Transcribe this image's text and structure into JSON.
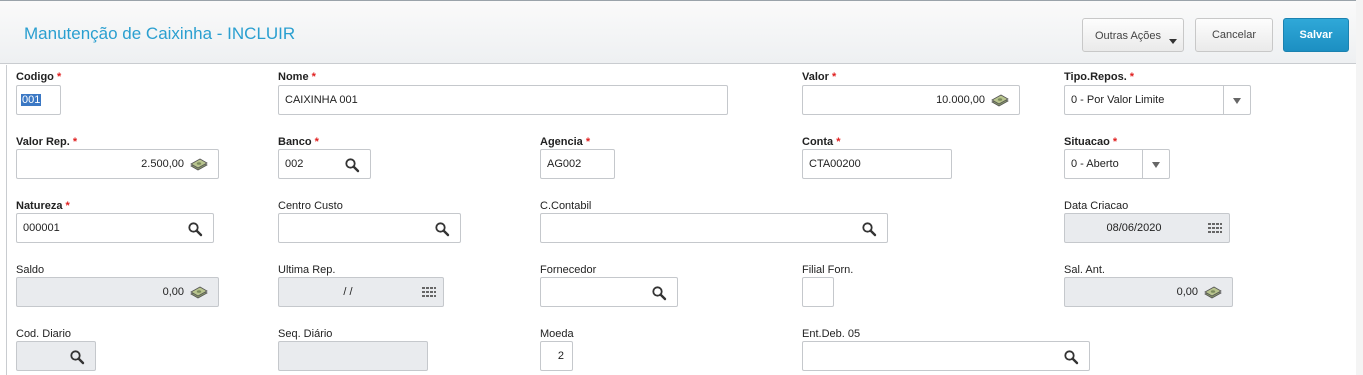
{
  "header": {
    "title": "Manutenção de Caixinha - INCLUIR",
    "buttons": {
      "other": "Outras Ações",
      "cancel": "Cancelar",
      "save": "Salvar"
    }
  },
  "fields": {
    "codigo": {
      "label": "Codigo",
      "value": "001"
    },
    "nome": {
      "label": "Nome",
      "value": "CAIXINHA 001"
    },
    "valor": {
      "label": "Valor",
      "value": "10.000,00"
    },
    "tipo_repos": {
      "label": "Tipo.Repos.",
      "value": "0 - Por Valor Limite"
    },
    "valor_rep": {
      "label": "Valor Rep.",
      "value": "2.500,00"
    },
    "banco": {
      "label": "Banco",
      "value": "002"
    },
    "agencia": {
      "label": "Agencia",
      "value": "AG002"
    },
    "conta": {
      "label": "Conta",
      "value": "CTA00200"
    },
    "situacao": {
      "label": "Situacao",
      "value": "0 - Aberto"
    },
    "natureza": {
      "label": "Natureza",
      "value": "000001"
    },
    "centro_custo": {
      "label": "Centro Custo",
      "value": ""
    },
    "c_contabil": {
      "label": "C.Contabil",
      "value": ""
    },
    "data_criacao": {
      "label": "Data Criacao",
      "value": "08/06/2020"
    },
    "saldo": {
      "label": "Saldo",
      "value": "0,00"
    },
    "ultima_rep": {
      "label": "Ultima Rep.",
      "value": "/ /"
    },
    "fornecedor": {
      "label": "Fornecedor",
      "value": ""
    },
    "filial_forn": {
      "label": "Filial Forn.",
      "value": ""
    },
    "sal_ant": {
      "label": "Sal. Ant.",
      "value": "0,00"
    },
    "cod_diario": {
      "label": "Cod. Diario",
      "value": ""
    },
    "seq_diario": {
      "label": "Seq. Diário",
      "value": ""
    },
    "moeda": {
      "label": "Moeda",
      "value": "2"
    },
    "ent_deb_05": {
      "label": "Ent.Deb. 05",
      "value": ""
    }
  },
  "colors": {
    "accent": "#2a9fd0",
    "save_button": "#1c8fc2",
    "required": "#e02020",
    "readonly_bg": "#e9ebee"
  },
  "icons": {
    "lookup": "search-icon",
    "money": "money-icon",
    "calendar": "calendar-icon",
    "dropdown": "chevron-down-icon"
  }
}
